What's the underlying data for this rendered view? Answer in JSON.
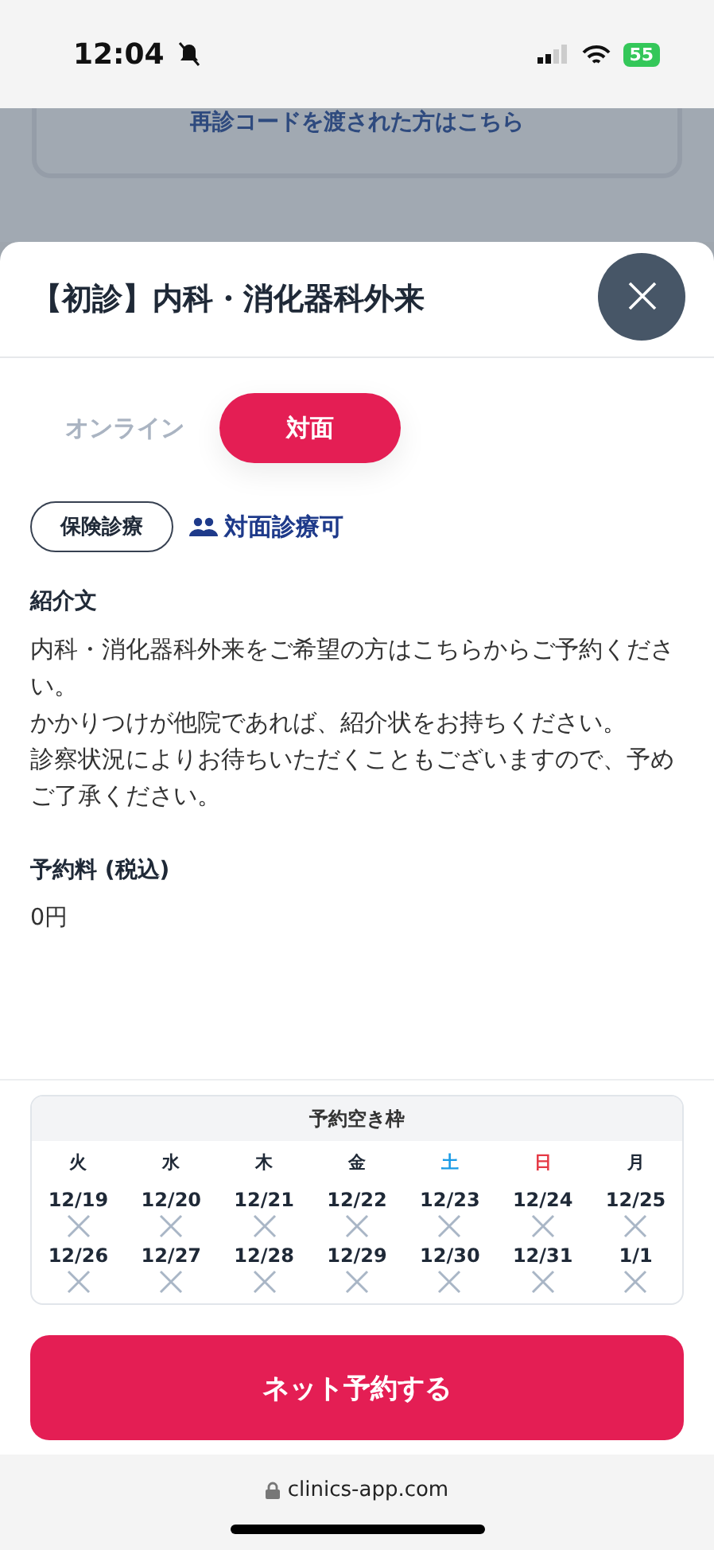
{
  "status_bar": {
    "time": "12:04",
    "battery": "55"
  },
  "background": {
    "link": "再診コードを渡された方はこちら"
  },
  "sheet": {
    "title": "【初診】内科・消化器科外来"
  },
  "tabs": [
    {
      "label": "オンライン",
      "selected": false
    },
    {
      "label": "対面",
      "selected": true
    }
  ],
  "tags": [
    {
      "kind": "outline",
      "label": "保険診療"
    },
    {
      "kind": "icon",
      "label": "対面診療可"
    }
  ],
  "intro": {
    "heading": "紹介文",
    "lines": [
      "内科・消化器科外来をご希望の方はこちらからご予約ください。",
      "かかりつけが他院であれば、紹介状をお持ちください。",
      "診察状況によりお待ちいただくこともございますので、予めご了承ください。"
    ]
  },
  "fee": {
    "heading": "予約料 (税込)",
    "value": "0円"
  },
  "calendar": {
    "title": "予約空き枠",
    "weekdays": [
      {
        "label": "火",
        "color": "#1f2937"
      },
      {
        "label": "水",
        "color": "#1f2937"
      },
      {
        "label": "木",
        "color": "#1f2937"
      },
      {
        "label": "金",
        "color": "#1f2937"
      },
      {
        "label": "土",
        "color": "#1a9be6"
      },
      {
        "label": "日",
        "color": "#e53945"
      },
      {
        "label": "月",
        "color": "#1f2937"
      }
    ],
    "slots": [
      {
        "date": "12/19",
        "available": false
      },
      {
        "date": "12/20",
        "available": false
      },
      {
        "date": "12/21",
        "available": false
      },
      {
        "date": "12/22",
        "available": false
      },
      {
        "date": "12/23",
        "available": false
      },
      {
        "date": "12/24",
        "available": false
      },
      {
        "date": "12/25",
        "available": false
      },
      {
        "date": "12/26",
        "available": false
      },
      {
        "date": "12/27",
        "available": false
      },
      {
        "date": "12/28",
        "available": false
      },
      {
        "date": "12/29",
        "available": false
      },
      {
        "date": "12/30",
        "available": false
      },
      {
        "date": "12/31",
        "available": false
      },
      {
        "date": "1/1",
        "available": false
      }
    ]
  },
  "book_button": "ネット予約する",
  "browser_bar": {
    "url": "clinics-app.com"
  }
}
